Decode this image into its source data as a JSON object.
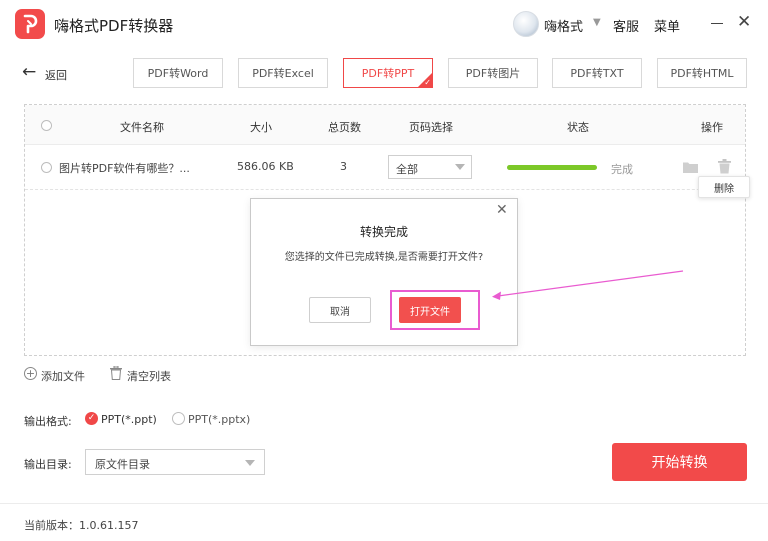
{
  "app": {
    "title": "嗨格式PDF转换器"
  },
  "header": {
    "username": "嗨格式",
    "service": "客服",
    "menu": "菜单"
  },
  "nav": {
    "back_label": "返回"
  },
  "tabs": [
    {
      "label": "PDF转Word",
      "active": false
    },
    {
      "label": "PDF转Excel",
      "active": false
    },
    {
      "label": "PDF转PPT",
      "active": true
    },
    {
      "label": "PDF转图片",
      "active": false
    },
    {
      "label": "PDF转TXT",
      "active": false
    },
    {
      "label": "PDF转HTML",
      "active": false
    }
  ],
  "table": {
    "headers": {
      "name": "文件名称",
      "size": "大小",
      "pages": "总页数",
      "range": "页码选择",
      "status": "状态",
      "actions": "操作"
    },
    "rows": [
      {
        "name": "图片转PDF软件有哪些？...",
        "size": "586.06 KB",
        "pages": "3",
        "range": "全部",
        "progress": 1.0,
        "status": "完成"
      }
    ]
  },
  "tooltip": {
    "delete": "删除"
  },
  "dialog": {
    "title": "转换完成",
    "message": "您选择的文件已完成转换,是否需要打开文件?",
    "cancel_label": "取消",
    "open_label": "打开文件"
  },
  "file_actions": {
    "add": "添加文件",
    "clear": "清空列表"
  },
  "output": {
    "format_label": "输出格式:",
    "format_options": [
      "PPT(*.ppt)",
      "PPT(*.pptx)"
    ],
    "selected_format": "PPT(*.ppt)",
    "dir_label": "输出目录:",
    "dir_value": "原文件目录"
  },
  "start_button": "开始转换",
  "footer": {
    "version": "当前版本：1.0.61.157"
  },
  "colors": {
    "accent": "#f24a4a",
    "progress": "#7cc828",
    "highlight": "#e95bd0"
  }
}
